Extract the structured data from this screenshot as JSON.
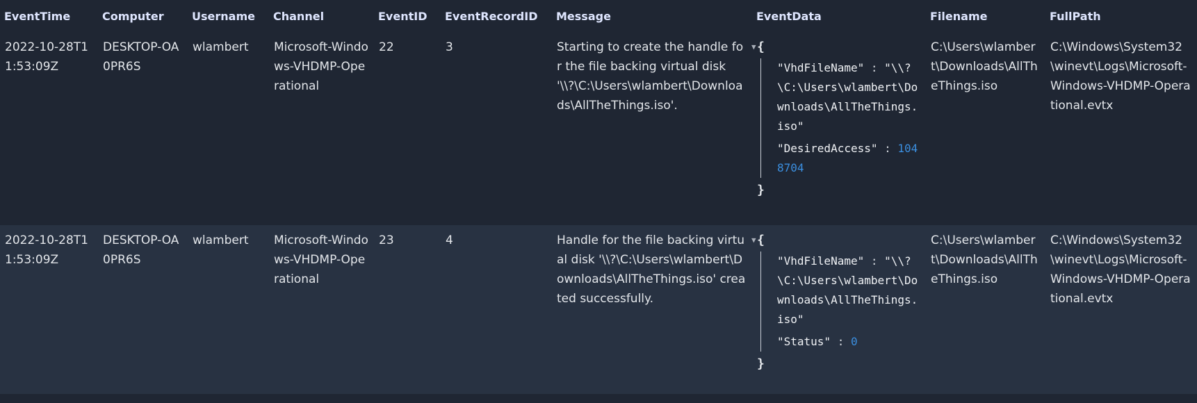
{
  "columns": [
    "EventTime",
    "Computer",
    "Username",
    "Channel",
    "EventID",
    "EventRecordID",
    "Message",
    "EventData",
    "Filename",
    "FullPath"
  ],
  "rows": [
    {
      "EventTime": "2022-10-28T11:53:09Z",
      "Computer": "DESKTOP-OA0PR6S",
      "Username": "wlambert",
      "Channel": "Microsoft-Windows-VHDMP-Operational",
      "EventID": "22",
      "EventRecordID": "3",
      "Message": "Starting to create the handle for the file backing virtual disk '\\\\?\\C:\\Users\\wlambert\\Downloads\\AllTheThings.iso'.",
      "EventData": {
        "open": "{",
        "close": "}",
        "k1": "\"VhdFileName\"",
        "v1": "\"\\\\?\\C:\\Users\\wlambert\\Downloads\\AllTheThings.iso\"",
        "k2": "\"DesiredAccess\"",
        "v2": "1048704"
      },
      "Filename": "C:\\Users\\wlambert\\Downloads\\AllTheThings.iso",
      "FullPath": "C:\\Windows\\System32\\winevt\\Logs\\Microsoft-Windows-VHDMP-Operational.evtx"
    },
    {
      "EventTime": "2022-10-28T11:53:09Z",
      "Computer": "DESKTOP-OA0PR6S",
      "Username": "wlambert",
      "Channel": "Microsoft-Windows-VHDMP-Operational",
      "EventID": "23",
      "EventRecordID": "4",
      "Message": "Handle for the file backing virtual disk '\\\\?\\C:\\Users\\wlambert\\Downloads\\AllTheThings.iso' created successfully.",
      "EventData": {
        "open": "{",
        "close": "}",
        "k1": "\"VhdFileName\"",
        "v1": "\"\\\\?\\C:\\Users\\wlambert\\Downloads\\AllTheThings.iso\"",
        "k2": "\"Status\"",
        "v2": "0"
      },
      "Filename": "C:\\Users\\wlambert\\Downloads\\AllTheThings.iso",
      "FullPath": "C:\\Windows\\System32\\winevt\\Logs\\Microsoft-Windows-VHDMP-Operational.evtx"
    }
  ],
  "colors": {
    "background": "#1f2633",
    "row_alt": "#283242",
    "number": "#3b8fe0",
    "header": "#dfe6ff"
  },
  "icons": {
    "expand": "caret-down-icon"
  }
}
